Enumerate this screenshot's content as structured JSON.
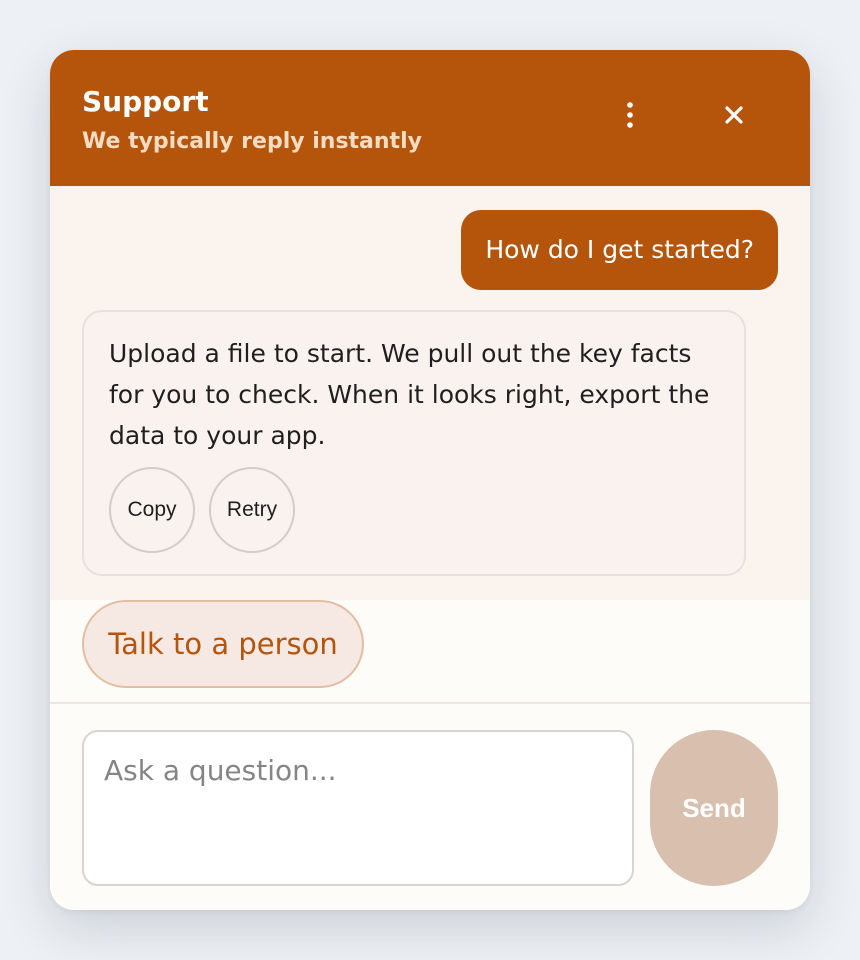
{
  "header": {
    "title": "Support",
    "subtitle": "We typically reply instantly",
    "menu_icon": "more-vertical-icon",
    "close_icon": "close-icon"
  },
  "conversation": {
    "user_message": "How do I get started?",
    "bot_message": "Upload a file to start. We pull out the key facts for you to check. When it looks right, export the data to your app.",
    "actions": {
      "copy": "Copy",
      "retry": "Retry"
    }
  },
  "quick_action": {
    "label": "Talk to a person"
  },
  "composer": {
    "placeholder": "Ask a question...",
    "value": "",
    "send_label": "Send"
  },
  "colors": {
    "accent": "#b5540b",
    "subtitle": "#f6dcc2",
    "messages_background": "#fbf4ee",
    "send_disabled": "#d8bfae"
  }
}
